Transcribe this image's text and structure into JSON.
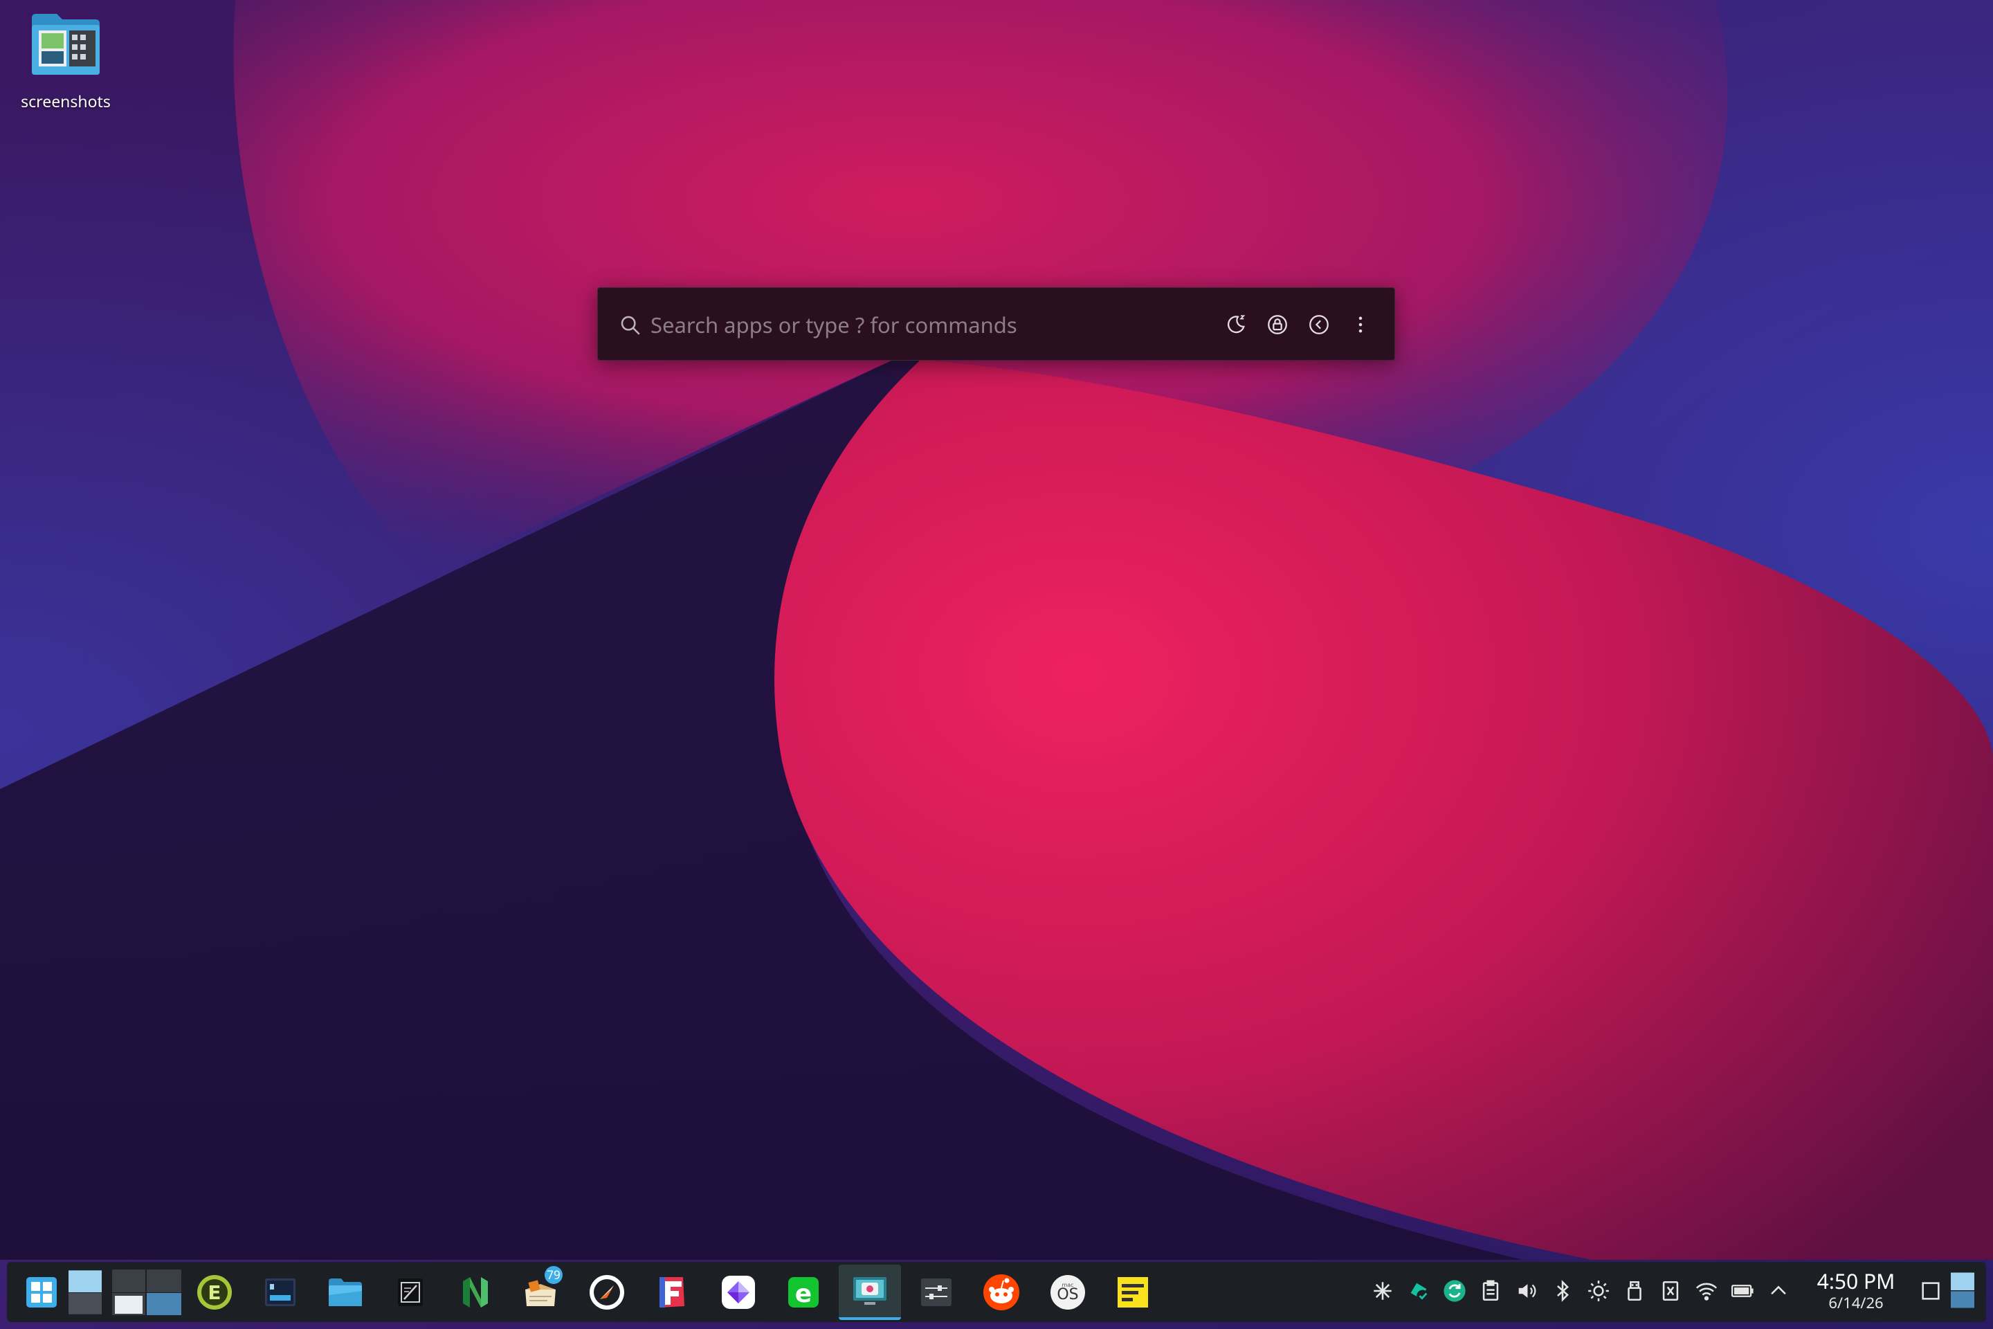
{
  "desktop": {
    "icons": [
      {
        "label": "screenshots",
        "icon": "folder-icon"
      }
    ]
  },
  "krunner": {
    "placeholder": "Search apps or type ? for commands",
    "value": "",
    "buttons": [
      {
        "icon": "night-light-icon"
      },
      {
        "icon": "lock-icon"
      },
      {
        "icon": "back-icon"
      },
      {
        "icon": "more-options-icon"
      }
    ]
  },
  "taskbar": {
    "launchers": [
      {
        "icon": "application-launcher-icon"
      },
      {
        "icon": "virtual-desktop-pager-icon"
      },
      {
        "icon": "window-switcher-icon"
      },
      {
        "icon": "env-manager-icon"
      },
      {
        "icon": "terminal-icon"
      },
      {
        "icon": "file-manager-icon"
      },
      {
        "icon": "text-editor-icon"
      },
      {
        "icon": "neovim-icon"
      },
      {
        "icon": "notes-icon",
        "badge": "79"
      },
      {
        "icon": "clock-app-icon"
      },
      {
        "icon": "fonts-app-icon"
      },
      {
        "icon": "gem-app-icon"
      },
      {
        "icon": "e-app-icon"
      },
      {
        "icon": "screenshot-app-icon",
        "active": true
      },
      {
        "icon": "settings-app-icon"
      },
      {
        "icon": "reddit-icon"
      },
      {
        "icon": "macos-icon"
      },
      {
        "icon": "sticky-notes-icon"
      }
    ],
    "tray": [
      {
        "icon": "asterisk-icon"
      },
      {
        "icon": "sync-icon"
      },
      {
        "icon": "refresh-icon"
      },
      {
        "icon": "clipboard-icon"
      },
      {
        "icon": "volume-icon"
      },
      {
        "icon": "bluetooth-icon"
      },
      {
        "icon": "brightness-icon"
      },
      {
        "icon": "usb-icon"
      },
      {
        "icon": "keepassxc-icon"
      },
      {
        "icon": "wifi-icon"
      },
      {
        "icon": "battery-icon"
      },
      {
        "icon": "tray-expand-icon"
      }
    ],
    "clock": {
      "time": "4:50 PM",
      "date": "6/14/26"
    },
    "extras": [
      {
        "icon": "show-desktop-icon"
      },
      {
        "icon": "peek-desktop-icon"
      }
    ]
  },
  "colors": {
    "accent": "#3daee9",
    "panel": "#1c1f24",
    "krunner_bg": "#2a0f20",
    "wall_pink": "#e8205f",
    "wall_purple": "#2a1457"
  }
}
